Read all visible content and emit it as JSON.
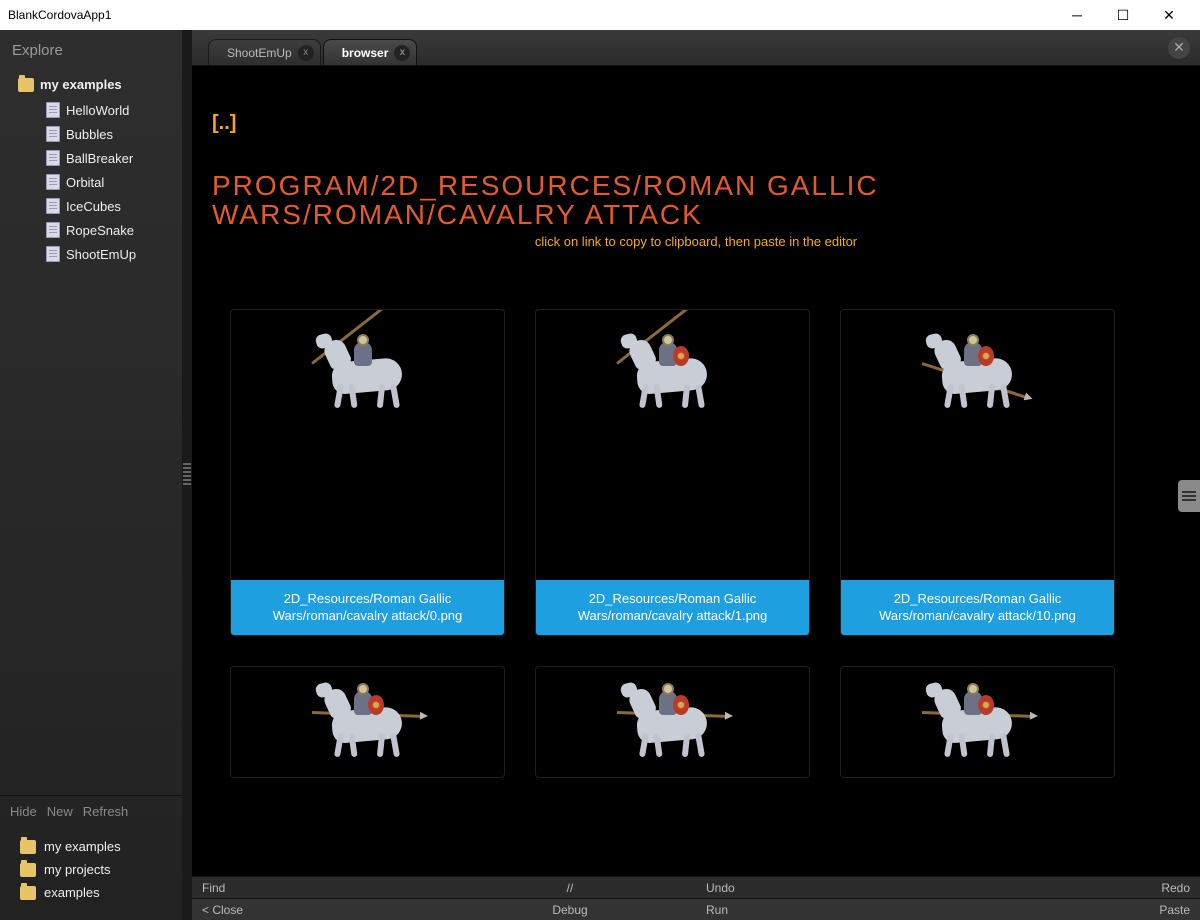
{
  "window": {
    "title": "BlankCordovaApp1"
  },
  "sidebar": {
    "title": "Explore",
    "root": "my examples",
    "items": [
      "HelloWorld",
      "Bubbles",
      "BallBreaker",
      "Orbital",
      "IceCubes",
      "RopeSnake",
      "ShootEmUp"
    ],
    "actions": [
      "Hide",
      "New",
      "Refresh"
    ],
    "folders": [
      "my examples",
      "my projects",
      "examples"
    ]
  },
  "tabs": [
    {
      "label": "ShootEmUp",
      "active": false
    },
    {
      "label": "browser",
      "active": true
    }
  ],
  "viewer": {
    "parent": "[..]",
    "path": "PROGRAM/2D_RESOURCES/ROMAN GALLIC WARS/ROMAN/CAVALRY ATTACK",
    "hint": "click on link to copy to clipboard, then paste in the editor",
    "items": [
      {
        "label": "2D_Resources/Roman Gallic Wars/roman/cavalry attack/0.png",
        "lance": "diag-up",
        "shield": "none"
      },
      {
        "label": "2D_Resources/Roman Gallic Wars/roman/cavalry attack/1.png",
        "lance": "diag-up",
        "shield": "red"
      },
      {
        "label": "2D_Resources/Roman Gallic Wars/roman/cavalry attack/10.png",
        "lance": "diag-down",
        "shield": "red"
      },
      {
        "label": "",
        "lance": "horiz",
        "shield": "red"
      },
      {
        "label": "",
        "lance": "horiz",
        "shield": "red"
      },
      {
        "label": "",
        "lance": "horiz",
        "shield": "red"
      }
    ]
  },
  "footer1": {
    "left": "Find",
    "mid": "//",
    "right_a": "Undo",
    "right_b": "Redo"
  },
  "footer2": {
    "left": "< Close",
    "mid": "Debug",
    "right_a": "Run",
    "right_b": "Paste"
  }
}
